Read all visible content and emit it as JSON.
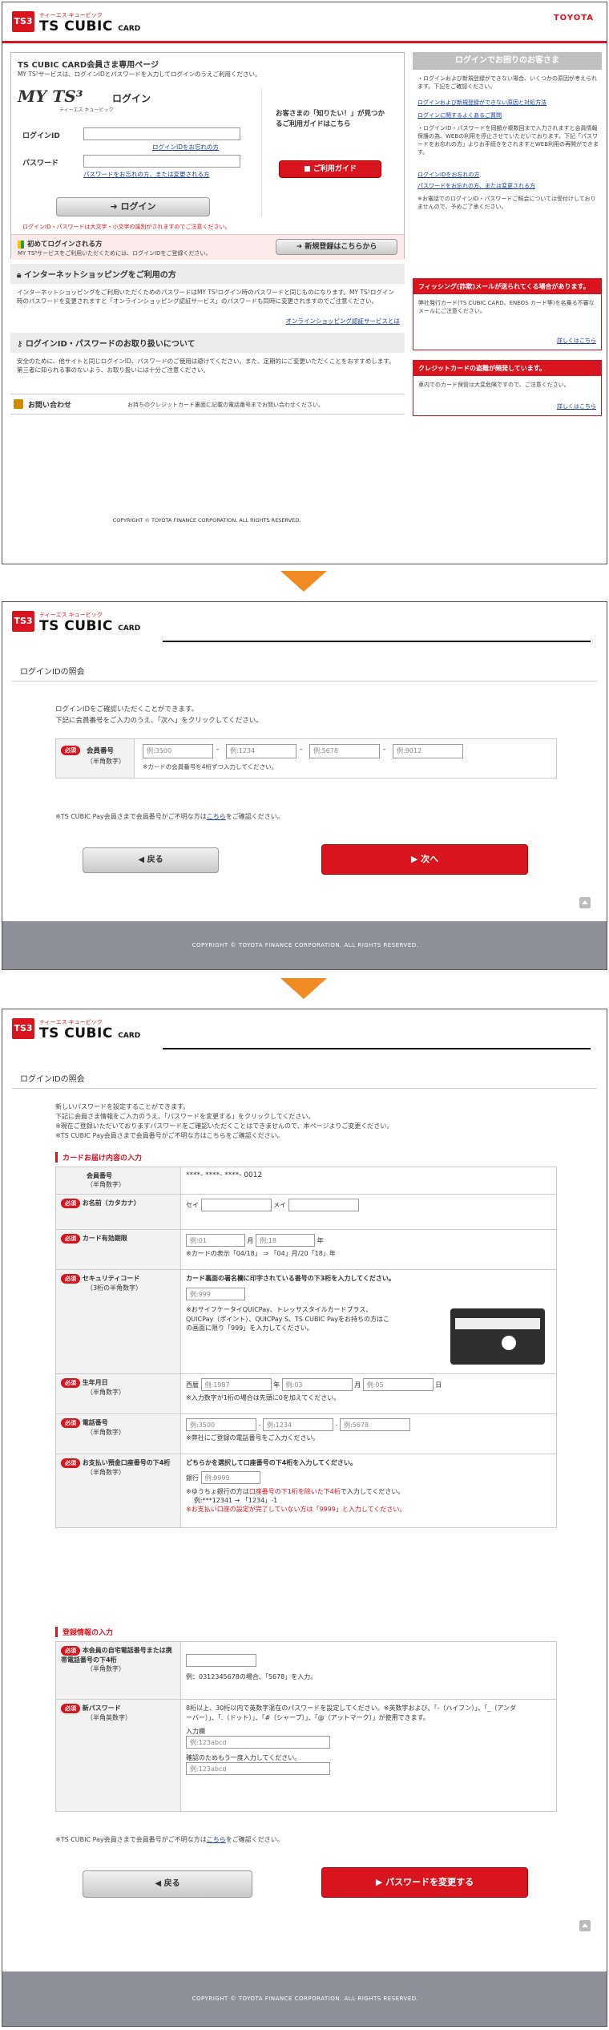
{
  "brand": {
    "logo": "TS3",
    "name": "TS CUBIC",
    "card": "CARD",
    "sub": "ティーエス キュービック",
    "toyota": "TOYOTA"
  },
  "s1": {
    "title": "TS CUBIC CARD会員さま専用ページ",
    "intro": "MY TS³サービスは、ログインIDとパスワードを入力してログインのうえご利用ください。",
    "myts_logo": "MY TS³",
    "myts_sub": "ティーエス キュービック",
    "login_head": "ログイン",
    "id_label": "ログインID",
    "id_forgot": "ログインIDをお忘れの方",
    "pw_label": "パスワード",
    "pw_forgot": "パスワードをお忘れの方、または変更される方",
    "login_btn": "ログイン",
    "note": "ログインID・パスワードは大文字・小文字の識別がされますのでご注意ください。",
    "guide_text": "お客さまの「知りたい！」が見つかるご利用ガイドはこちら",
    "guide_btn": "ご利用ガイド",
    "first_title": "初めてログインされる方",
    "first_text": "MY TS³サービスをご利用いただくためには、ログインIDをご登録ください。",
    "register_btn": "新規登録はこちらから",
    "shop_title": "インターネットショッピングをご利用の方",
    "shop_text": "インターネットショッピングをご利用いただくためのパスワードはMY TS³ログイン時のパスワードと同じものになります。MY TS³ログイン時のパスワードを変更されますと「オンラインショッピング認証サービス」のパスワードも同時に変更されますのでご注意ください。",
    "shop_link": "オンラインショッピング認証サービスとは",
    "handle_title": "ログインID・パスワードのお取り扱いについて",
    "handle_text": "安全のために、他サイトと同じログインID、パスワードのご使用は避けてください。また、定期的にご変更いただくことをおすすめします。第三者に知られる事のないよう、お取り扱いには十分ご注意ください。",
    "contact_title": "お問い合わせ",
    "contact_text": "お持ちのクレジットカード裏面に記載の電話番号までお問い合わせください。",
    "copyright": "COPYRIGHT © TOYOTA FINANCE CORPORATION. ALL RIGHTS RESERVED.",
    "help_head": "ログインでお困りのお客さま",
    "help_text1": "・ログインおよび新規登録ができない場合、いくつかの原因が考えられます。下記をご確認ください。",
    "help_link1": "ログインおよび新規登録ができない原因と対処方法",
    "help_link2": "ログインに関するよくあるご質問",
    "help_text2": "・ログインID・パスワードを同額か複数回まで入力されますと会員情報保護の為、WEBの利用を停止させていただいております。下記「パスワードをお忘れの方」よりお手続きをされますとWEB利用の再開ができます。",
    "help_link3": "ログインIDをお忘れの方",
    "help_link4": "パスワードをお忘れの方、または変更される方",
    "help_text3": "※お電話でのログインID・パスワードご照会については受付けしておりませんので、予めご了承ください。",
    "phish_head": "フィッシング(詐欺)メールが送られてくる場合があります。",
    "phish_text": "弊社発行カード(TS CUBIC CARD、ENEOS カード等)を名乗る不審なメールにご注意ください。",
    "phish_link": "詳しくはこちら",
    "fraud_head": "クレジットカードの盗難が頻発しています。",
    "fraud_text": "車内でのカード保管は大変危険ですので、ご注意ください。",
    "fraud_link": "詳しくはこちら"
  },
  "s2": {
    "title": "ログインIDの照会",
    "intro1": "ログインIDをご確認いただくことができます。",
    "intro2": "下記に会員番号をご入力のうえ、「次へ」をクリックしてください。",
    "req": "必須",
    "field_label": "会員番号",
    "field_sub": "（半角数字）",
    "ph1": "例:3500",
    "ph2": "例:1234",
    "ph3": "例:5678",
    "ph4": "例:9012",
    "field_note": "※カードの会員番号を4桁ずつ入力してください。",
    "pay_note_a": "※TS CUBIC Pay会員さまで会員番号がご不明な方は",
    "pay_link": "こちら",
    "pay_note_b": "をご確認ください。",
    "back_btn": "戻る",
    "next_btn": "次へ",
    "copyright": "COPYRIGHT © TOYOTA FINANCE CORPORATION. ALL RIGHTS RESERVED."
  },
  "s3": {
    "title": "ログインIDの照会",
    "intro1": "新しいパスワードを設定することができます。",
    "intro2": "下記に会員さま情報をご入力のうえ、「パスワードを変更する」をクリックしてください。",
    "intro3": "※現在ご登録いただいておりますパスワードをご確認いただくことはできませんので、本ページよりご変更ください。",
    "intro4": "※TS CUBIC Pay会員さまで会員番号がご不明な方はこちらをご確認ください。",
    "sec1": "カードお届け内容の入力",
    "req": "必須",
    "member_label": "会員番号",
    "member_sub": "（半角数字）",
    "member_val": "****- ****- ****- 0012",
    "name_label": "お名前（カタカナ）",
    "sei": "セイ",
    "mei": "メイ",
    "exp_label": "カード有効期限",
    "exp_ph1": "例:01",
    "exp_m": "月",
    "exp_ph2": "例:18",
    "exp_y": "年",
    "exp_note": "※カードの表示「04/18」 ⇒ 「04」月/20「18」年",
    "sec_label": "セキュリティコード",
    "sec_sub": "（3桁の半角数字）",
    "sec_head": "カード裏面の署名欄に印字されている番号の下3桁を入力してください。",
    "sec_ph": "例:999",
    "sec_note": "※おサイフケータイQUICPay、トレッサスタイルカードプラス、QUICPay（ポイント）、QUICPay S、TS CUBIC Payをお持ちの方はこの画面に限り「999」を入力してください。",
    "birth_label": "生年月日",
    "birth_sub": "（半角数字）",
    "birth_era": "西暦",
    "birth_ph1": "例:1987",
    "birth_y": "年",
    "birth_ph2": "例:03",
    "birth_m": "月",
    "birth_ph3": "例:05",
    "birth_d": "日",
    "birth_note": "※入力数字が1桁の場合は先頭に0を加えてください。",
    "tel_label": "電話番号",
    "tel_sub": "（半角数字）",
    "tel_ph1": "例:3500",
    "tel_ph2": "例:1234",
    "tel_ph3": "例:5678",
    "tel_note": "※弊社にご登録の電話番号をご入力ください。",
    "bank_label": "お支払い預金口座番号の下4桁",
    "bank_sub": "（半角数字）",
    "bank_head": "どちらかを選択して口座番号の下4桁を入力してください。",
    "bank_pre": "銀行",
    "bank_ph": "例:9999",
    "bank_note1a": "※ゆうちょ銀行の方は",
    "bank_note1b": "口座番号の下1桁を除いた下4桁",
    "bank_note1c": "で入力してください。",
    "bank_note2": "例:***12341 → 「1234」-1",
    "bank_note3": "※お支払い口座の設定が完了していない方は「9999」と入力してください。",
    "sec2": "登録情報の入力",
    "home_label": "本会員の自宅電話番号または携帯電話番号の下4桁",
    "home_sub": "（半角数字）",
    "home_note": "例：0312345678の場合、「5678」を入力。",
    "pw_label": "新パスワード",
    "pw_sub": "（半角英数字）",
    "pw_note": "8桁以上、30桁以内で英数字混在のパスワードを設定してください。※英数字および、「-（ハイフン）」、「_（アンダーバー）」、「.（ドット）」、「#（シャープ）」、「@（アットマーク）」が使用できます。",
    "pw_in": "入力欄",
    "pw_ph1": "例:123abcd",
    "pw_conf": "確認のためもう一度入力してください。",
    "pw_ph2": "例:123abcd",
    "pay_note_a": "※TS CUBIC Pay会員さまで会員番号がご不明な方は",
    "pay_link": "こちら",
    "pay_note_b": "をご確認ください。",
    "back_btn": "戻る",
    "submit_btn": "パスワードを変更する",
    "copyright": "COPYRIGHT © TOYOTA FINANCE CORPORATION. ALL RIGHTS RESERVED."
  },
  "colors": {
    "brand_red": "#d8141e",
    "arrow": "#f08a22",
    "footer": "#8e9099"
  }
}
